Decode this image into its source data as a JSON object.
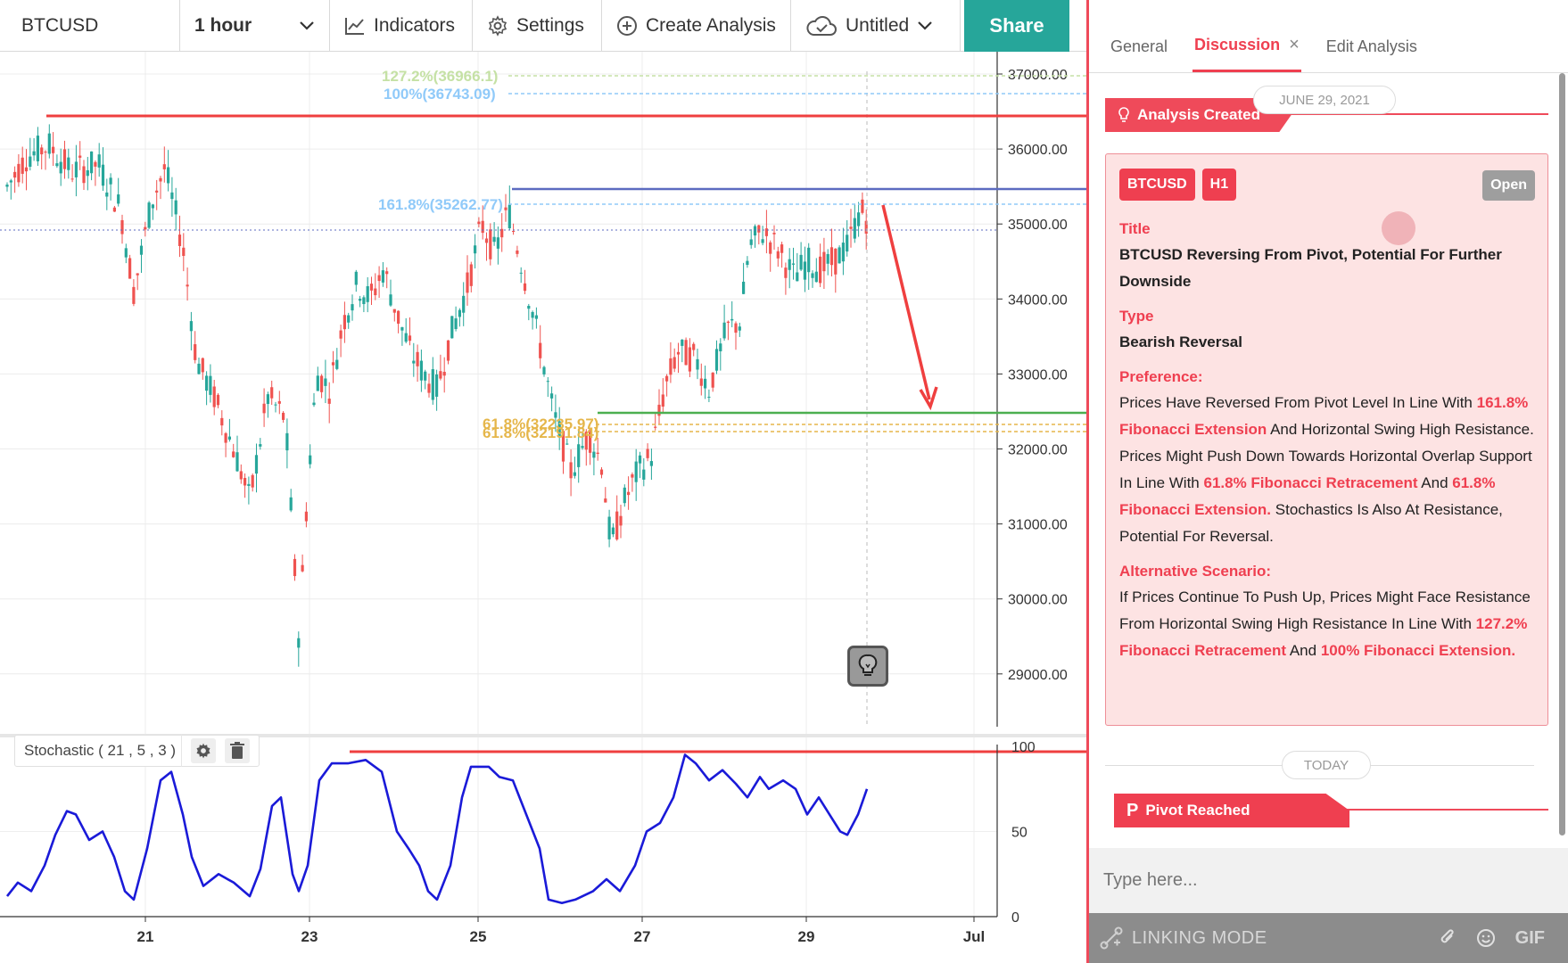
{
  "toolbar": {
    "symbol": "BTCUSD",
    "interval": "1 hour",
    "indicators": "Indicators",
    "settings": "Settings",
    "create_analysis": "Create Analysis",
    "untitled": "Untitled",
    "share": "Share"
  },
  "chart": {
    "price_labels": [
      "37000.00",
      "36000.00",
      "35000.00",
      "34000.00",
      "33000.00",
      "32000.00",
      "31000.00",
      "30000.00",
      "29000.00"
    ],
    "price_values": [
      37000,
      36000,
      35000,
      34000,
      33000,
      32000,
      31000,
      30000,
      29000
    ],
    "date_labels": [
      "21",
      "23",
      "25",
      "27",
      "29",
      "Jul"
    ],
    "fib_labels": {
      "ext_1272": "127.2%(36966.1)",
      "ext_100": "100%(36743.09)",
      "ext_1618": "161.8%(35262.77)",
      "ret_618_a": "61.8%(32235.97)",
      "ret_618_b": "61.8%(32191.84)"
    },
    "stochastic_label": "Stochastic ( 21 , 5 , 3 )",
    "stochastic_levels": [
      "100",
      "50",
      "0"
    ],
    "colors": {
      "up": "#26a69a",
      "down": "#ef5350",
      "resistance": "#ef3f3f",
      "pivot": "#5c6bc0",
      "support": "#4caf50",
      "fib_blue": "#90caf9",
      "fib_green": "#c5e1a5",
      "fib_gold": "#e5b64a",
      "stoch": "#1a1ad8"
    }
  },
  "panel": {
    "tabs": {
      "general": "General",
      "discussion": "Discussion",
      "edit": "Edit Analysis",
      "close": "×"
    },
    "date1": "JUNE 29, 2021",
    "analysis_created": "Analysis Created",
    "card": {
      "symbol": "BTCUSD",
      "timeframe": "H1",
      "status": "Open",
      "title_label": "Title",
      "title": "BTCUSD Reversing From Pivot, Potential For Further Downside",
      "type_label": "Type",
      "type": "Bearish Reversal",
      "pref_label": "Preference:",
      "pref_1": "Prices Have Reversed From Pivot Level In Line With ",
      "pref_h1": "161.8% Fibonacci Extension",
      "pref_2": " And Horizontal Swing High Resistance. Prices Might Push Down Towards Horizontal Overlap Support In Line With ",
      "pref_h2": "61.8% Fibonacci Retracement",
      "pref_3": " And ",
      "pref_h3": "61.8% Fibonacci Extension.",
      "pref_4": " Stochastics Is Also At Resistance, Potential For Reversal.",
      "alt_label": "Alternative Scenario:",
      "alt_1": "If Prices Continue To Push Up, Prices Might Face Resistance From Horizontal Swing High Resistance In Line With ",
      "alt_h1": "127.2% Fibonacci Retracement",
      "alt_2": " And ",
      "alt_h2": "100% Fibonacci Extension."
    },
    "today": "TODAY",
    "pivot_reached": "Pivot Reached",
    "composer_placeholder": "Type here...",
    "linking_mode": "LINKING MODE",
    "gif": "GIF"
  }
}
